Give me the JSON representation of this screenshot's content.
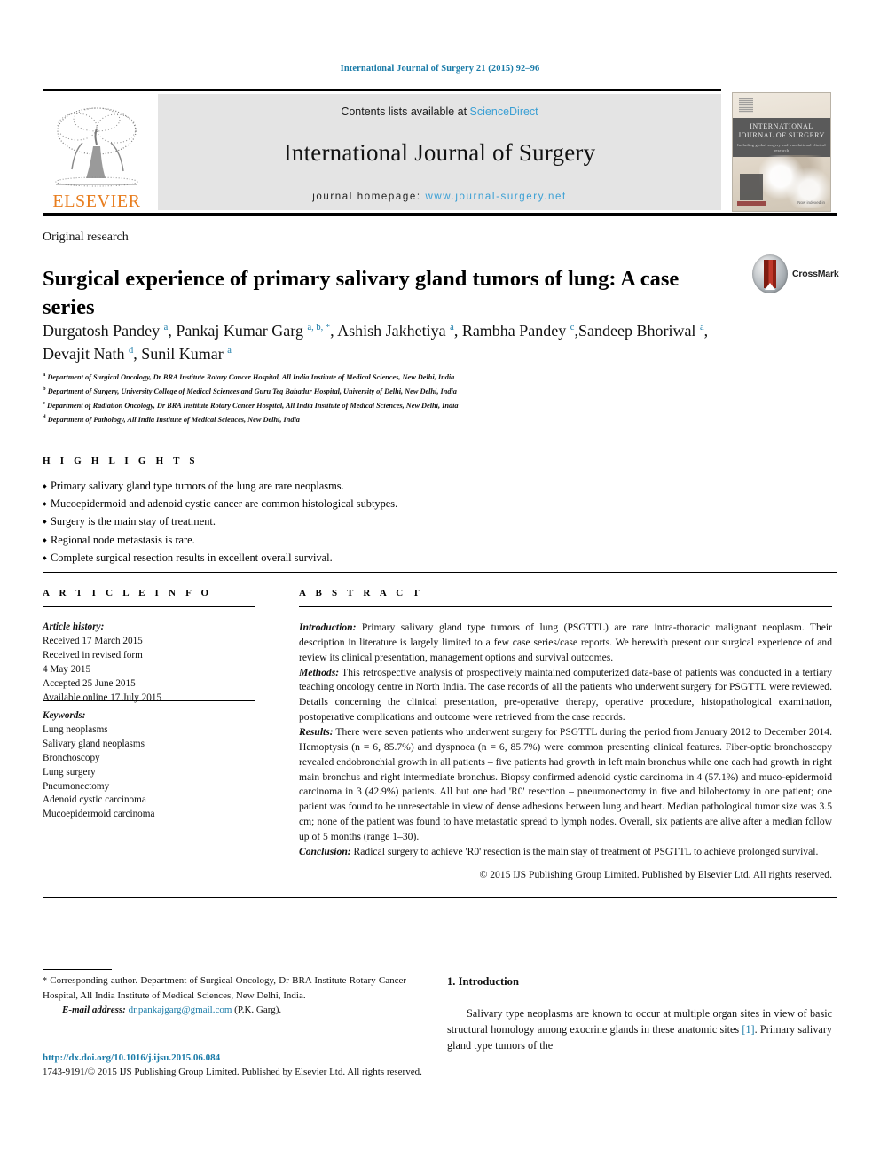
{
  "running_head": "International Journal of Surgery 21 (2015) 92–96",
  "masthead": {
    "contents_prefix": "Contents lists available at ",
    "sciencedirect": "ScienceDirect",
    "journal_title": "International Journal of Surgery",
    "homepage_prefix": "journal homepage: ",
    "homepage_url": "www.journal-surgery.net",
    "publisher_wordmark": "ELSEVIER",
    "cover_title_line1": "INTERNATIONAL",
    "cover_title_line2": "JOURNAL OF SURGERY",
    "cover_subtitle": "Including global surgery and translational clinical research",
    "cover_footnote": "Now indexed in"
  },
  "article": {
    "type": "Original research",
    "title": "Surgical experience of primary salivary gland tumors of lung: A case series",
    "crossmark_label": "CrossMark",
    "authors": [
      {
        "name": "Durgatosh Pandey",
        "marks": "a",
        "sep": ", "
      },
      {
        "name": "Pankaj Kumar Garg",
        "marks": "a, b, *",
        "sep": ", "
      },
      {
        "name": "Ashish Jakhetiya",
        "marks": "a",
        "sep": ", "
      },
      {
        "name": "Rambha Pandey",
        "marks": "c",
        "sep": ","
      },
      {
        "name": "Sandeep Bhoriwal",
        "marks": "a",
        "sep": ", "
      },
      {
        "name": "Devajit Nath",
        "marks": "d",
        "sep": ", "
      },
      {
        "name": "Sunil Kumar",
        "marks": "a",
        "sep": ""
      }
    ],
    "affiliations": [
      {
        "mark": "a",
        "text": "Department of Surgical Oncology, Dr BRA Institute Rotary Cancer Hospital, All India Institute of Medical Sciences, New Delhi, India"
      },
      {
        "mark": "b",
        "text": "Department of Surgery, University College of Medical Sciences and Guru Teg Bahadur Hospital, University of Delhi, New Delhi, India"
      },
      {
        "mark": "c",
        "text": "Department of Radiation Oncology, Dr BRA Institute Rotary Cancer Hospital, All India Institute of Medical Sciences, New Delhi, India"
      },
      {
        "mark": "d",
        "text": "Department of Pathology, All India Institute of Medical Sciences, New Delhi, India"
      }
    ]
  },
  "highlights": {
    "label": "H I G H L I G H T S",
    "items": [
      "Primary salivary gland type tumors of the lung are rare neoplasms.",
      "Mucoepidermoid and adenoid cystic cancer are common histological subtypes.",
      "Surgery is the main stay of treatment.",
      "Regional node metastasis is rare.",
      "Complete surgical resection results in excellent overall survival."
    ]
  },
  "article_info": {
    "label": "A R T I C L E  I N F O",
    "history_heading": "Article history:",
    "history": [
      "Received 17 March 2015",
      "Received in revised form",
      "4 May 2015",
      "Accepted 25 June 2015",
      "Available online 17 July 2015"
    ],
    "keywords_heading": "Keywords:",
    "keywords": [
      "Lung neoplasms",
      "Salivary gland neoplasms",
      "Bronchoscopy",
      "Lung surgery",
      "Pneumonectomy",
      "Adenoid cystic carcinoma",
      "Mucoepidermoid carcinoma"
    ]
  },
  "abstract": {
    "label": "A B S T R A C T",
    "introduction_label": "Introduction:",
    "introduction_text": " Primary salivary gland type tumors of lung (PSGTTL) are rare intra-thoracic malignant neoplasm. Their description in literature is largely limited to a few case series/case reports. We herewith present our surgical experience of and review its clinical presentation, management options and survival outcomes.",
    "methods_label": "Methods:",
    "methods_text": " This retrospective analysis of prospectively maintained computerized data-base of patients was conducted in a tertiary teaching oncology centre in North India. The case records of all the patients who underwent surgery for PSGTTL were reviewed. Details concerning the clinical presentation, pre-operative therapy, operative procedure, histopathological examination, postoperative complications and outcome were retrieved from the case records.",
    "results_label": "Results:",
    "results_text": " There were seven patients who underwent surgery for PSGTTL during the period from January 2012 to December 2014. Hemoptysis (n = 6, 85.7%) and dyspnoea (n = 6, 85.7%) were common presenting clinical features. Fiber-optic bronchoscopy revealed endobronchial growth in all patients – five patients had growth in left main bronchus while one each had growth in right main bronchus and right intermediate bronchus. Biopsy confirmed adenoid cystic carcinoma in 4 (57.1%) and muco-epidermoid carcinoma in 3 (42.9%) patients. All but one had 'R0' resection – pneumonectomy in five and bilobectomy in one patient; one patient was found to be unresectable in view of dense adhesions between lung and heart. Median pathological tumor size was 3.5 cm; none of the patient was found to have metastatic spread to lymph nodes. Overall, six patients are alive after a median follow up of 5 months (range 1–30).",
    "conclusion_label": "Conclusion:",
    "conclusion_text": " Radical surgery to achieve 'R0' resection is the main stay of treatment of PSGTTL to achieve prolonged survival.",
    "copyright": "© 2015 IJS Publishing Group Limited. Published by Elsevier Ltd. All rights reserved."
  },
  "footnote": {
    "star": "*",
    "corresponding_text": " Corresponding author. Department of Surgical Oncology, Dr BRA Institute Rotary Cancer Hospital, All India Institute of Medical Sciences, New Delhi, India.",
    "email_label": "E-mail address:",
    "email": "dr.pankajgarg@gmail.com",
    "email_owner": " (P.K. Garg)."
  },
  "doi": {
    "url": "http://dx.doi.org/10.1016/j.ijsu.2015.06.084",
    "issn_line": "1743-9191/© 2015 IJS Publishing Group Limited. Published by Elsevier Ltd. All rights reserved."
  },
  "introduction": {
    "heading": "1. Introduction",
    "text_before_ref": "Salivary type neoplasms are known to occur at multiple organ sites in view of basic structural homology among exocrine glands in these anatomic sites ",
    "reference": "[1]",
    "text_after_ref": ". Primary salivary gland type tumors of the"
  },
  "colors": {
    "link": "#1a7ba8",
    "sciencedirect": "#3a9fd4",
    "elsevier_orange": "#E87D1E",
    "band_gray": "#e4e4e4"
  }
}
